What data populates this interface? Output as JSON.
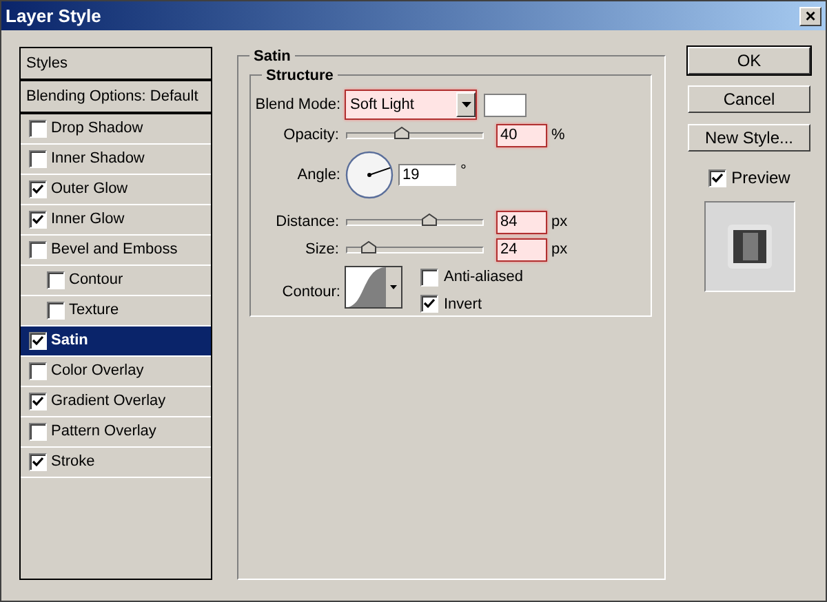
{
  "window": {
    "title": "Layer Style",
    "close": "×"
  },
  "styles": [
    {
      "label": "Styles",
      "kind": "header",
      "selected": false
    },
    {
      "label": "Blending Options: Default",
      "kind": "header",
      "selected": false
    },
    {
      "label": "Drop Shadow",
      "kind": "effect",
      "checked": false,
      "selected": false
    },
    {
      "label": "Inner Shadow",
      "kind": "effect",
      "checked": false,
      "selected": false
    },
    {
      "label": "Outer Glow",
      "kind": "effect",
      "checked": true,
      "selected": false
    },
    {
      "label": "Inner Glow",
      "kind": "effect",
      "checked": true,
      "selected": false
    },
    {
      "label": "Bevel and Emboss",
      "kind": "effect",
      "checked": false,
      "selected": false,
      "children": [
        {
          "label": "Contour",
          "kind": "effect",
          "checked": false,
          "selected": false
        },
        {
          "label": "Texture",
          "kind": "effect",
          "checked": false,
          "selected": false
        }
      ]
    },
    {
      "label": "Satin",
      "kind": "effect",
      "checked": true,
      "selected": true
    },
    {
      "label": "Color Overlay",
      "kind": "effect",
      "checked": false,
      "selected": false
    },
    {
      "label": "Gradient Overlay",
      "kind": "effect",
      "checked": true,
      "selected": false
    },
    {
      "label": "Pattern Overlay",
      "kind": "effect",
      "checked": false,
      "selected": false
    },
    {
      "label": "Stroke",
      "kind": "effect",
      "checked": true,
      "selected": false
    }
  ],
  "panel": {
    "title": "Satin",
    "group": "Structure",
    "blend_mode": {
      "label": "Blend Mode:",
      "value": "Soft Light"
    },
    "opacity": {
      "label": "Opacity:",
      "level": 0.4,
      "value": "40",
      "unit": "%"
    },
    "angle": {
      "label": "Angle:",
      "value": "19",
      "unit": "°"
    },
    "distance": {
      "label": "Distance:",
      "level": 0.6,
      "value": "84",
      "unit": "px"
    },
    "size": {
      "label": "Size:",
      "level": 0.15,
      "value": "24",
      "unit": "px"
    },
    "contour": {
      "label": "Contour:"
    },
    "anti_aliased": {
      "label": "Anti-aliased",
      "checked": false
    },
    "invert": {
      "label": "Invert",
      "checked": true
    }
  },
  "buttons": [
    "OK",
    "Cancel",
    "New Style..."
  ],
  "preview": {
    "label": "Preview",
    "checked": true
  }
}
